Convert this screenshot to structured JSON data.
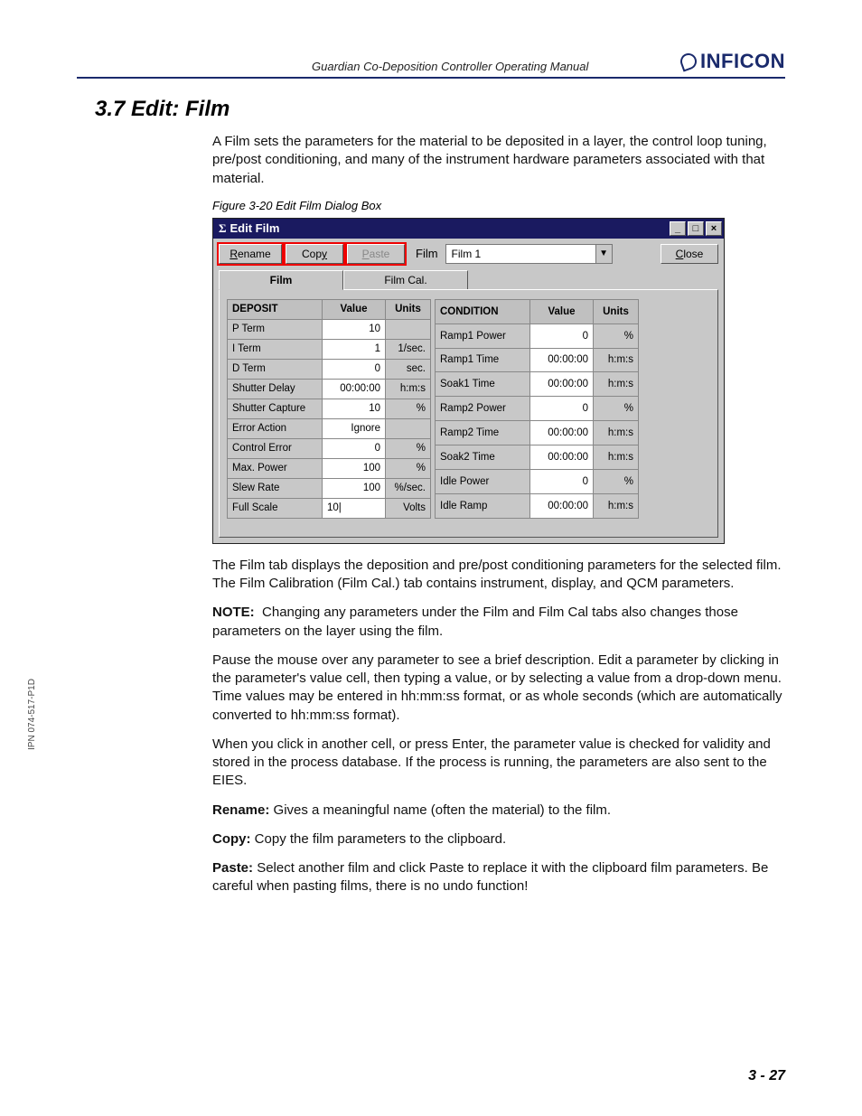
{
  "header": {
    "running": "Guardian Co-Deposition Controller Operating Manual",
    "logo_text": "INFICON"
  },
  "section_title": "3.7  Edit: Film",
  "intro": "A Film sets the parameters for the material to be deposited in a layer, the control loop tuning, pre/post conditioning, and many of the instrument hardware parameters associated with that material.",
  "figure_caption": "Figure 3-20  Edit Film Dialog Box",
  "dialog": {
    "title_prefix": "Σ",
    "title": "Edit Film",
    "win_min": "_",
    "win_max": "□",
    "win_close": "×",
    "btn_rename": "Rename",
    "btn_copy": "Copy",
    "btn_paste": "Paste",
    "film_label": "Film",
    "film_value": "Film 1",
    "btn_close": "Close",
    "tab_film": "Film",
    "tab_filmcal": "Film Cal.",
    "deposit_header": "DEPOSIT",
    "value_header": "Value",
    "units_header": "Units",
    "condition_header": "CONDITION",
    "deposit_rows": [
      {
        "label": "P Term",
        "value": "10",
        "units": ""
      },
      {
        "label": "I Term",
        "value": "1",
        "units": "1/sec."
      },
      {
        "label": "D Term",
        "value": "0",
        "units": "sec."
      },
      {
        "label": "Shutter Delay",
        "value": "00:00:00",
        "units": "h:m:s"
      },
      {
        "label": "Shutter Capture",
        "value": "10",
        "units": "%"
      },
      {
        "label": "Error Action",
        "value": "Ignore",
        "units": ""
      },
      {
        "label": "Control Error",
        "value": "0",
        "units": "%"
      },
      {
        "label": "Max. Power",
        "value": "100",
        "units": "%"
      },
      {
        "label": "Slew Rate",
        "value": "100",
        "units": "%/sec."
      },
      {
        "label": "Full Scale",
        "value": "10",
        "units": "Volts",
        "editing": true
      }
    ],
    "condition_rows": [
      {
        "label": "Ramp1 Power",
        "value": "0",
        "units": "%"
      },
      {
        "label": "Ramp1 Time",
        "value": "00:00:00",
        "units": "h:m:s"
      },
      {
        "label": "Soak1 Time",
        "value": "00:00:00",
        "units": "h:m:s"
      },
      {
        "label": "Ramp2 Power",
        "value": "0",
        "units": "%"
      },
      {
        "label": "Ramp2 Time",
        "value": "00:00:00",
        "units": "h:m:s"
      },
      {
        "label": "Soak2 Time",
        "value": "00:00:00",
        "units": "h:m:s"
      },
      {
        "label": "Idle Power",
        "value": "0",
        "units": "%"
      },
      {
        "label": "Idle Ramp",
        "value": "00:00:00",
        "units": "h:m:s"
      }
    ]
  },
  "para_filmtab": "The Film tab displays the deposition and pre/post conditioning parameters for the selected film. The Film Calibration (Film Cal.) tab contains instrument, display, and QCM parameters.",
  "note_label": "NOTE:",
  "note_text": "Changing any parameters under the Film and Film Cal tabs also changes those parameters on the layer using the film.",
  "para_pause": "Pause the mouse over any parameter to see a brief description. Edit a parameter by clicking in the parameter's value cell, then typing a value, or by selecting a value from a drop-down menu. Time values may be entered in hh:mm:ss format, or as whole seconds (which are automatically converted to hh:mm:ss format).",
  "para_click": "When you click in another cell, or press Enter, the parameter value is checked for validity and stored in the process database. If the process is running, the parameters are also sent to the EIES.",
  "rename_label": "Rename:",
  "rename_text": "Gives a meaningful name (often the material) to the film.",
  "copy_label": "Copy:",
  "copy_text": "Copy the film parameters to the clipboard.",
  "paste_label": "Paste:",
  "paste_text": "Select another film and click Paste to replace it with the clipboard film parameters. Be careful when pasting films, there is no undo function!",
  "side_code": "IPN 074-517-P1D",
  "page_number": "3 - 27"
}
